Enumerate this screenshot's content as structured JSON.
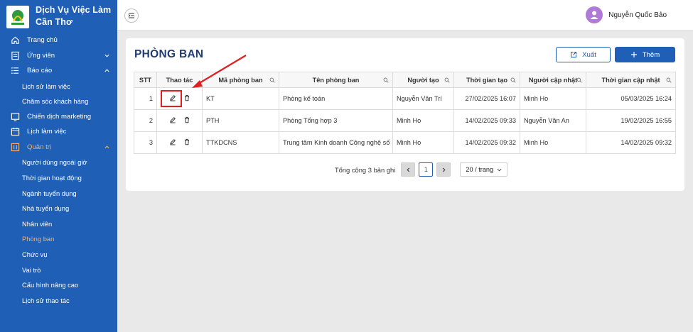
{
  "brand": {
    "name_line1": "Dịch Vụ Việc Làm",
    "name_line2": "Cần Thơ"
  },
  "sidebar": {
    "items": [
      {
        "label": "Trang chủ",
        "icon": "home-icon"
      },
      {
        "label": "Ứng viên",
        "icon": "candidate-icon",
        "has_chevron": "down"
      },
      {
        "label": "Báo cáo",
        "icon": "list-icon",
        "has_chevron": "up"
      },
      {
        "label": "Lịch sử làm việc"
      },
      {
        "label": "Chăm sóc khách hàng"
      },
      {
        "label": "Chiến dịch marketing",
        "icon": "campaign-icon"
      },
      {
        "label": "Lịch làm việc",
        "icon": "calendar-icon"
      },
      {
        "label": "Quản trị",
        "icon": "admin-icon",
        "has_chevron": "up"
      },
      {
        "label": "Người dùng ngoài giờ"
      },
      {
        "label": "Thời gian hoạt động"
      },
      {
        "label": "Ngành tuyển dụng"
      },
      {
        "label": "Nhà tuyển dụng"
      },
      {
        "label": "Nhân viên"
      },
      {
        "label": "Phòng ban"
      },
      {
        "label": "Chức vụ"
      },
      {
        "label": "Vai trò"
      },
      {
        "label": "Cấu hình nâng cao"
      },
      {
        "label": "Lịch sử thao tác"
      }
    ]
  },
  "header": {
    "user_name": "Nguyễn Quốc Bảo"
  },
  "page": {
    "title": "PHÒNG BAN",
    "export_label": "Xuất",
    "add_label": "Thêm"
  },
  "table": {
    "columns": [
      "STT",
      "Thao tác",
      "Mã phòng ban",
      "Tên phòng ban",
      "Người tạo",
      "Thời gian tạo",
      "Người cập nhật",
      "Thời gian cập nhật"
    ],
    "rows": [
      {
        "stt": "1",
        "code": "KT",
        "name": "Phòng kế toán",
        "creator": "Nguyễn Văn Trí",
        "created": "27/02/2025 16:07",
        "updater": "Minh Ho",
        "updated": "05/03/2025 16:24"
      },
      {
        "stt": "2",
        "code": "PTH",
        "name": "Phòng Tổng hợp 3",
        "creator": "Minh Ho",
        "created": "14/02/2025 09:33",
        "updater": "Nguyễn Văn An",
        "updated": "19/02/2025 16:55"
      },
      {
        "stt": "3",
        "code": "TTKDCNS",
        "name": "Trung tâm Kinh doanh Công nghệ số",
        "creator": "Minh Ho",
        "created": "14/02/2025 09:32",
        "updater": "Minh Ho",
        "updated": "14/02/2025 09:32"
      }
    ]
  },
  "pagination": {
    "total_text": "Tổng cộng 3 bản ghi",
    "current_page": "1",
    "page_size": "20 / trang"
  },
  "colors": {
    "sidebar": "#1f5fb5",
    "accent_orange": "#f6b26b",
    "title": "#1f3c74",
    "highlight": "#e02020"
  }
}
